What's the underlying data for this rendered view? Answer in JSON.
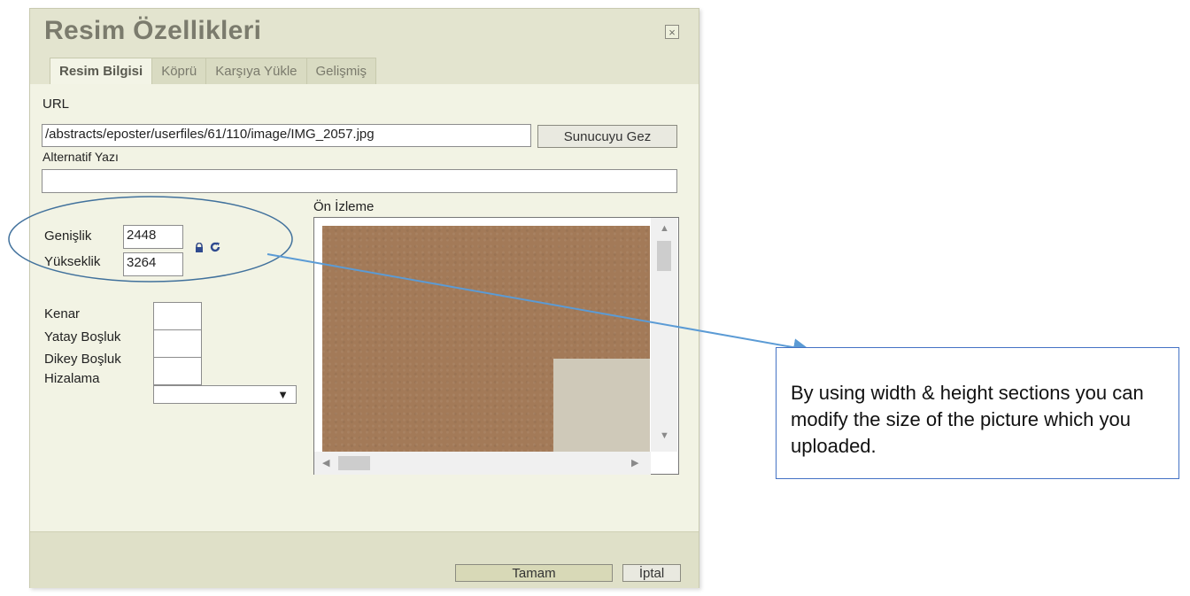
{
  "dialog": {
    "title": "Resim Özellikleri",
    "close_symbol": "×"
  },
  "tabs": [
    "Resim Bilgisi",
    "Köprü",
    "Karşıya Yükle",
    "Gelişmiş"
  ],
  "fields": {
    "url_label": "URL",
    "url_value": "/abstracts/eposter/userfiles/61/110/image/IMG_2057.jpg",
    "browse_button": "Sunucuyu Gez",
    "alt_label": "Alternatif Yazı",
    "alt_value": "",
    "preview_label": "Ön İzleme",
    "width_label": "Genişlik",
    "width_value": "2448",
    "height_label": "Yükseklik",
    "height_value": "3264",
    "border_label": "Kenar",
    "hspace_label": "Yatay Boşluk",
    "vspace_label": "Dikey Boşluk",
    "align_label": "Hizalama",
    "align_arrow": "▼"
  },
  "footer": {
    "ok_button": "Tamam",
    "cancel_button": "İptal"
  },
  "annotation": {
    "text": "By using width & height sections you can modify the size of the picture which you uploaded.",
    "ellipse_color": "#41719c",
    "arrow_color": "#5b9bd5",
    "box_border_color": "#4472c4"
  },
  "icons": {
    "lock": "lock-icon",
    "reset": "refresh-icon",
    "scroll_up": "▲",
    "scroll_down": "▼",
    "scroll_left": "◀",
    "scroll_right": "▶"
  }
}
